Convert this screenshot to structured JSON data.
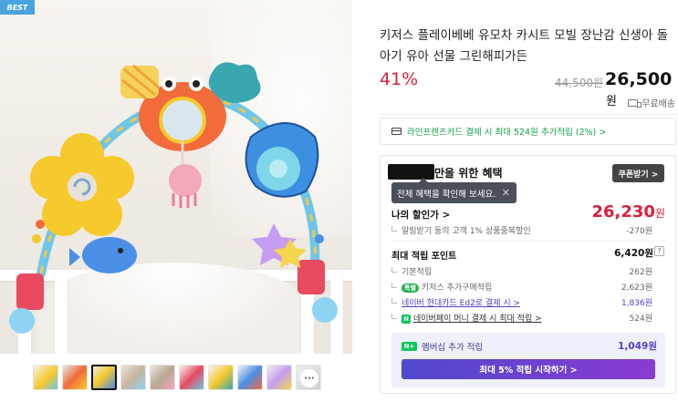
{
  "badge": {
    "best": "BEST"
  },
  "product": {
    "title": "키저스 플레이베베 유모차 카시트 모빌 장난감 신생아 돌아기 유아 선물 그린해피가든",
    "discount_rate": "41%",
    "original_price": "44,500원",
    "price_number": "26,500",
    "price_unit": "원",
    "delivery": "무료배송"
  },
  "card_promo": {
    "text": "라인프렌즈카드 결제 시 최대 524원 추가적립 (2%) >"
  },
  "benefit": {
    "title": "만을 위한 혜택",
    "coupon_button": "쿠폰받기 >",
    "tooltip": "전체 혜택을 확인해 보세요.",
    "my_discount_label": "나의 할인가 >",
    "my_discount_value": "26,230",
    "my_discount_unit": "원",
    "alarm_label": "알림받기 동의 고객 1% 상품중복할인",
    "alarm_value": "-270원",
    "points_label": "최대 적립 포인트",
    "points_value": "6,420원",
    "points_help": "?",
    "basic_label": "기본적립",
    "basic_value": "262원",
    "special_pill": "특별",
    "special_label": "키저스 추가구매적립",
    "special_value": "2,623원",
    "hyundai_label": "네이버 현대카드 Ed2로 결제 시 >",
    "hyundai_value": "1,836원",
    "naverpay_n": "N",
    "naverpay_label": "네이버페이 머니 결제 시 최대 적립 >",
    "naverpay_value": "524원",
    "member_badge": "N+",
    "member_label": "멤버십 추가 적립",
    "member_value": "1,049원",
    "member_button": "최대 5% 적립 시작하기 >"
  },
  "thumbnails": {
    "more": "···"
  },
  "colors": {
    "accent_red": "#d8203f",
    "accent_purple": "#5b3cc4",
    "naver_green": "#03c75a",
    "promo_green": "#16a34a"
  }
}
